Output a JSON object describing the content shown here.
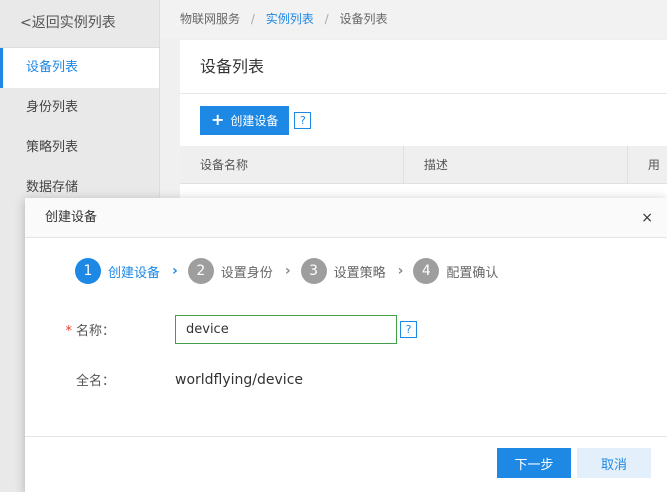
{
  "sidebar": {
    "back_label": "<返回实例列表",
    "items": [
      {
        "label": "设备列表"
      },
      {
        "label": "身份列表"
      },
      {
        "label": "策略列表"
      },
      {
        "label": "数据存储"
      }
    ]
  },
  "breadcrumb": {
    "items": [
      "物联网服务",
      "实例列表",
      "设备列表"
    ],
    "separator": "/"
  },
  "panel": {
    "title": "设备列表",
    "create_button": "创建设备",
    "help_icon": "?",
    "columns": [
      "设备名称",
      "描述",
      "用"
    ]
  },
  "modal": {
    "title": "创建设备",
    "close_icon": "×",
    "steps": [
      {
        "num": "1",
        "label": "创建设备"
      },
      {
        "num": "2",
        "label": "设置身份"
      },
      {
        "num": "3",
        "label": "设置策略"
      },
      {
        "num": "4",
        "label": "配置确认"
      }
    ],
    "arrow_icon": "›",
    "name_label": "名称：",
    "required_mark": "*",
    "name_value": "device",
    "help_icon": "?",
    "fullname_label": "全名：",
    "fullname_value": "worldflying/device",
    "next_button": "下一步",
    "cancel_button": "取消"
  },
  "colors": {
    "accent": "#1e88e5",
    "input_border": "#43a047",
    "required": "#e53935"
  }
}
